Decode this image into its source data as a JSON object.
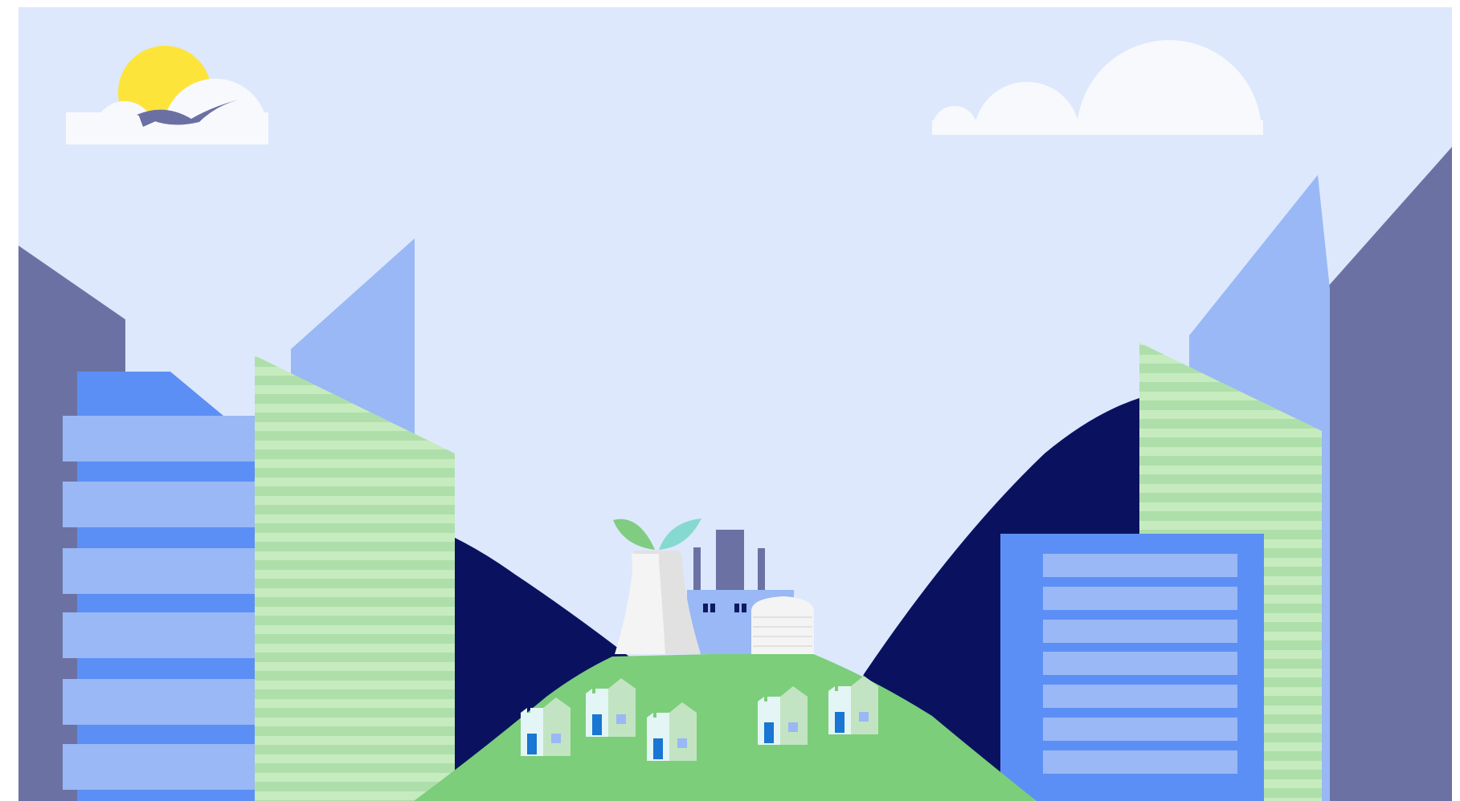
{
  "scene": {
    "colors": {
      "sky": "#dde8fc",
      "sun": "#fde43a",
      "cloud": "#f8f9fd",
      "bird": "#6b70a3",
      "slate_building": "#6b72a3",
      "royal_blue": "#5c8ff5",
      "light_blue": "#99b8f5",
      "stripe_green_dark": "#aedfaa",
      "stripe_green_light": "#c6ebbf",
      "navy_hill": "#0a1260",
      "grass": "#7cce7a",
      "plant_white": "#f4f4f4",
      "plant_shadow": "#e1e1e1",
      "leaf_green": "#80cc80",
      "leaf_teal": "#86d9cf",
      "chimney": "#6b72a3",
      "window_dark": "#0d1a60",
      "house_front": "#e4f5f6",
      "house_side": "#c3e4c2",
      "door": "#1976d2",
      "house_window": "#99b8f5"
    },
    "icons": [
      "sun-icon",
      "cloud-icon",
      "bird-icon",
      "leaf-icon",
      "house-icon"
    ]
  }
}
